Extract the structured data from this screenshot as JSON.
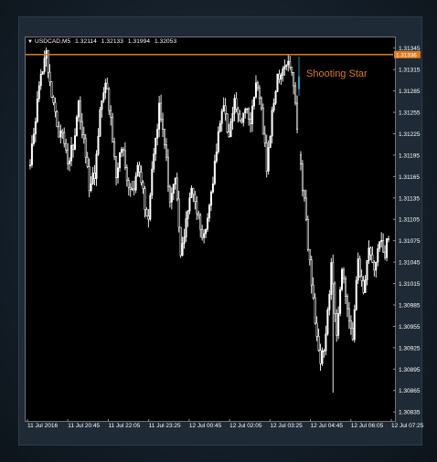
{
  "header": {
    "symbol": "USDCAD,M5",
    "open": "1.32114",
    "high": "1.32133",
    "low": "1.31994",
    "close": "1.32053"
  },
  "colors": {
    "background": "#000000",
    "candles": "#ffffff",
    "highlight_candle": "#1fa4c9",
    "level_line": "#e07a1c",
    "annotation": "#e07a1c",
    "axis_text": "#ffffff"
  },
  "chart_data": {
    "type": "candlestick",
    "symbol": "USDCAD,M5",
    "ylim": [
      1.30825,
      1.3136
    ],
    "yticks": [
      1.31345,
      1.31315,
      1.31285,
      1.31255,
      1.31225,
      1.31195,
      1.31165,
      1.31135,
      1.31105,
      1.31075,
      1.31045,
      1.31015,
      1.30985,
      1.30955,
      1.30925,
      1.30895,
      1.30865,
      1.30835
    ],
    "xticks": [
      "11 Jul 2016",
      "11 Jul 20:45",
      "11 Jul 22:05",
      "11 Jul 23:25",
      "12 Jul 00:45",
      "12 Jul 02:05",
      "12 Jul 03:25",
      "12 Jul 04:45",
      "12 Jul 06:05",
      "12 Jul 07:25"
    ],
    "level": {
      "price": 1.31336,
      "label": "1.31336"
    },
    "annotation": {
      "text": "Shooting Star"
    },
    "trend_closes": [
      1.3118,
      1.3125,
      1.3131,
      1.3134,
      1.3128,
      1.3123,
      1.3122,
      1.3118,
      1.3121,
      1.3127,
      1.3121,
      1.3115,
      1.3117,
      1.3125,
      1.313,
      1.3124,
      1.3116,
      1.3121,
      1.3116,
      1.3114,
      1.3118,
      1.3114,
      1.311,
      1.312,
      1.3126,
      1.3121,
      1.3113,
      1.3116,
      1.3106,
      1.311,
      1.3115,
      1.3112,
      1.3108,
      1.311,
      1.3116,
      1.3123,
      1.3126,
      1.3122,
      1.3128,
      1.3124,
      1.3126,
      1.3124,
      1.313,
      1.3126,
      1.3118,
      1.3125,
      1.313,
      1.3132,
      1.3133,
      1.3129,
      1.312,
      1.3113,
      1.3104,
      1.3096,
      1.309,
      1.3094,
      1.3104,
      1.3094,
      1.3103,
      1.3098,
      1.3094,
      1.3105,
      1.31,
      1.3106,
      1.3104,
      1.3108,
      1.3106,
      1.3109
    ]
  }
}
